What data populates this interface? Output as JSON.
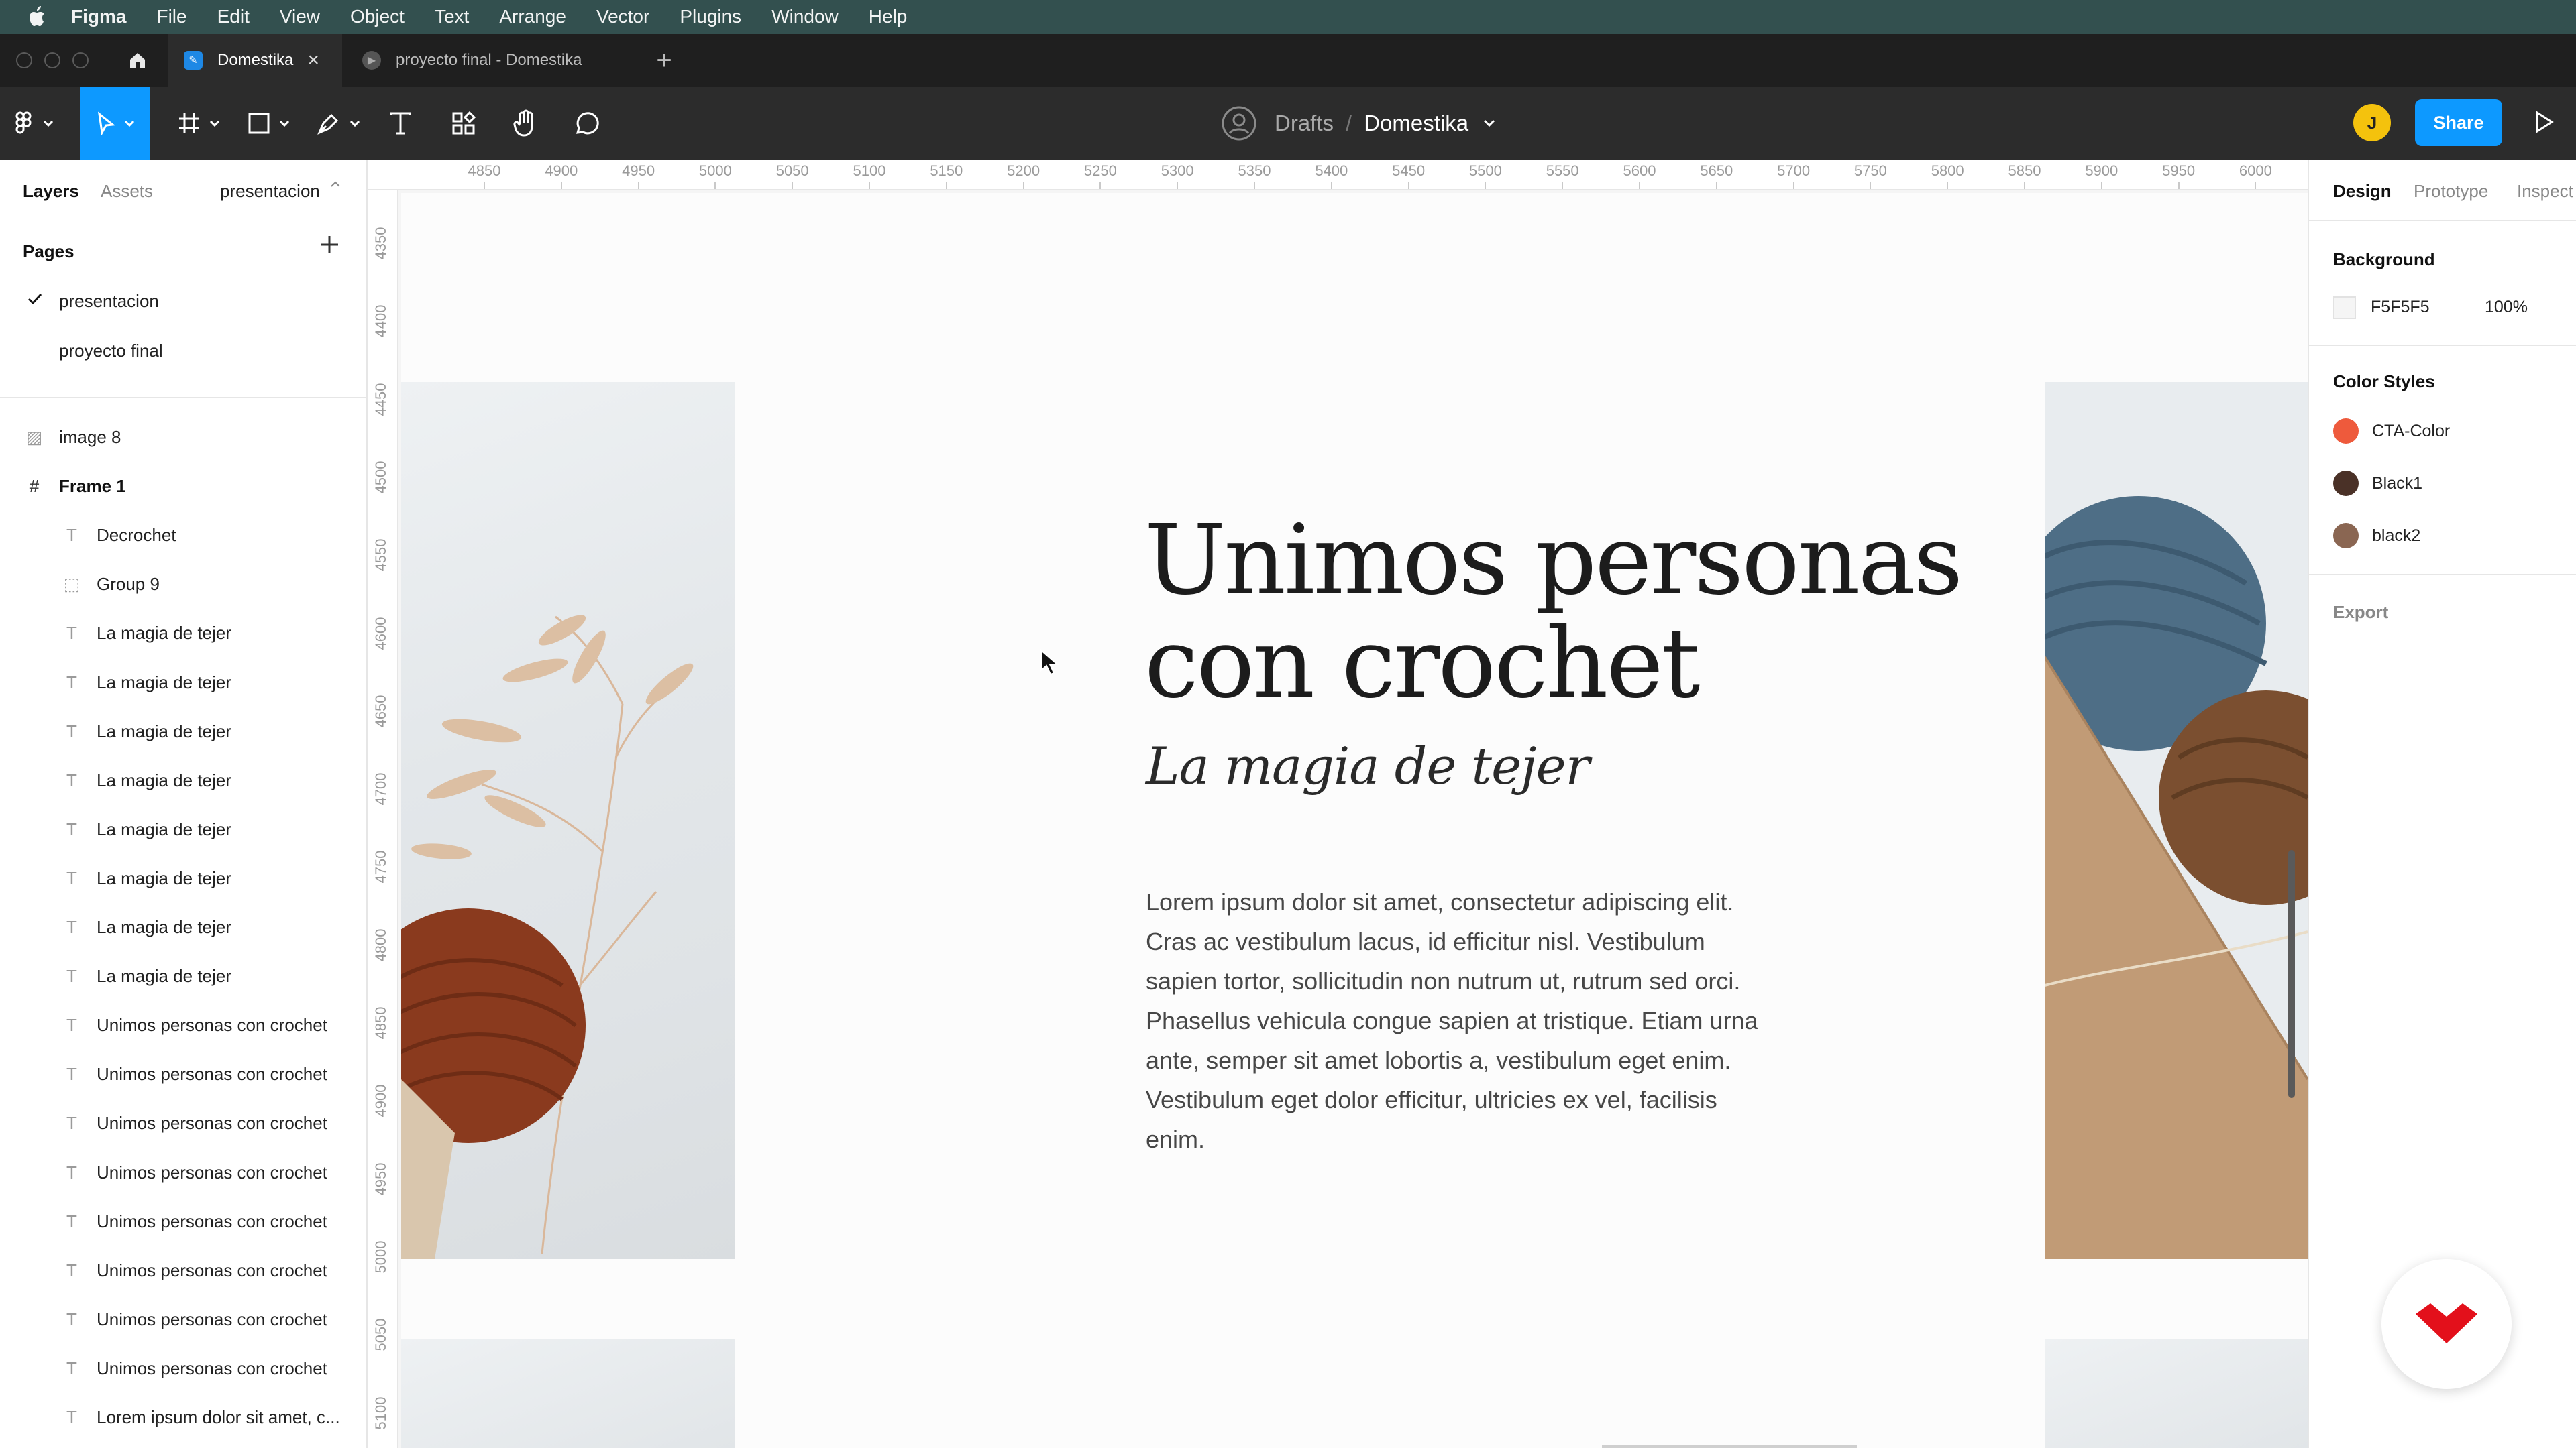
{
  "menubar": {
    "app_name": "Figma",
    "items": [
      "File",
      "Edit",
      "View",
      "Object",
      "Text",
      "Arrange",
      "Vector",
      "Plugins",
      "Window",
      "Help"
    ]
  },
  "tabs": [
    {
      "label": "Domestika",
      "active": true
    },
    {
      "label": "proyecto final - Domestika",
      "active": false
    }
  ],
  "toolbar": {
    "breadcrumb_root": "Drafts",
    "breadcrumb_sep": "/",
    "file_name": "Domestika",
    "avatar_initial": "J",
    "share_label": "Share",
    "accent_color": "#0d99ff"
  },
  "left_panel": {
    "tabs": [
      "Layers",
      "Assets"
    ],
    "current_page": "presentacion",
    "pages_title": "Pages",
    "pages": [
      {
        "name": "presentacion",
        "selected": true
      },
      {
        "name": "proyecto final",
        "selected": false
      }
    ],
    "layers": [
      {
        "name": "image 8",
        "icon": "image-icon",
        "level": 0
      },
      {
        "name": "Frame 1",
        "icon": "frame-icon",
        "level": 0
      },
      {
        "name": "Decrochet",
        "icon": "text-icon",
        "level": 1
      },
      {
        "name": "Group 9",
        "icon": "group-icon",
        "level": 1
      },
      {
        "name": "La magia de tejer",
        "icon": "text-icon",
        "level": 1
      },
      {
        "name": "La magia de tejer",
        "icon": "text-icon",
        "level": 1
      },
      {
        "name": "La magia de tejer",
        "icon": "text-icon",
        "level": 1
      },
      {
        "name": "La magia de tejer",
        "icon": "text-icon",
        "level": 1
      },
      {
        "name": "La magia de tejer",
        "icon": "text-icon",
        "level": 1
      },
      {
        "name": "La magia de tejer",
        "icon": "text-icon",
        "level": 1
      },
      {
        "name": "La magia de tejer",
        "icon": "text-icon",
        "level": 1
      },
      {
        "name": "La magia de tejer",
        "icon": "text-icon",
        "level": 1
      },
      {
        "name": "Unimos personas con crochet",
        "icon": "text-icon",
        "level": 1
      },
      {
        "name": "Unimos personas con crochet",
        "icon": "text-icon",
        "level": 1
      },
      {
        "name": "Unimos personas con crochet",
        "icon": "text-icon",
        "level": 1
      },
      {
        "name": "Unimos personas con crochet",
        "icon": "text-icon",
        "level": 1
      },
      {
        "name": "Unimos personas con crochet",
        "icon": "text-icon",
        "level": 1
      },
      {
        "name": "Unimos personas con crochet",
        "icon": "text-icon",
        "level": 1
      },
      {
        "name": "Unimos personas con crochet",
        "icon": "text-icon",
        "level": 1
      },
      {
        "name": "Unimos personas con crochet",
        "icon": "text-icon",
        "level": 1
      },
      {
        "name": "Lorem ipsum dolor sit amet, c...",
        "icon": "text-icon",
        "level": 1
      }
    ]
  },
  "canvas": {
    "ruler_x": [
      "4850",
      "4900",
      "4950",
      "5000",
      "5050",
      "5100",
      "5150",
      "5200",
      "5250",
      "5300",
      "5350",
      "5400",
      "5450",
      "5500",
      "5550",
      "5600",
      "5650",
      "5700",
      "5750",
      "5800",
      "5850",
      "5900",
      "5950",
      "6000"
    ],
    "ruler_y": [
      "4350",
      "4400",
      "4450",
      "4500",
      "4550",
      "4600",
      "4650",
      "4700",
      "4750",
      "4800",
      "4850",
      "4900",
      "4950",
      "5000",
      "5050",
      "5100"
    ],
    "heading_line1": "Unimos personas",
    "heading_line2": "con crochet",
    "subheading": "La magia de tejer",
    "body": "Lorem ipsum dolor sit amet, consectetur adipiscing elit. Cras ac vestibulum lacus, id efficitur nisl. Vestibulum sapien tortor, sollicitudin non nutrum ut, rutrum sed orci. Phasellus vehicula congue sapien at tristique. Etiam urna ante, semper sit amet lobortis a, vestibulum eget enim. Vestibulum eget dolor efficitur, ultricies ex vel, facilisis enim."
  },
  "right_panel": {
    "tabs": [
      "Design",
      "Prototype",
      "Inspect"
    ],
    "background_title": "Background",
    "background_hex": "F5F5F5",
    "background_opacity": "100%",
    "color_styles_title": "Color Styles",
    "color_styles": [
      {
        "name": "CTA-Color",
        "color": "#ee5a3c"
      },
      {
        "name": "Black1",
        "color": "#4a3127"
      },
      {
        "name": "black2",
        "color": "#8a6652"
      }
    ],
    "export_label": "Export"
  }
}
